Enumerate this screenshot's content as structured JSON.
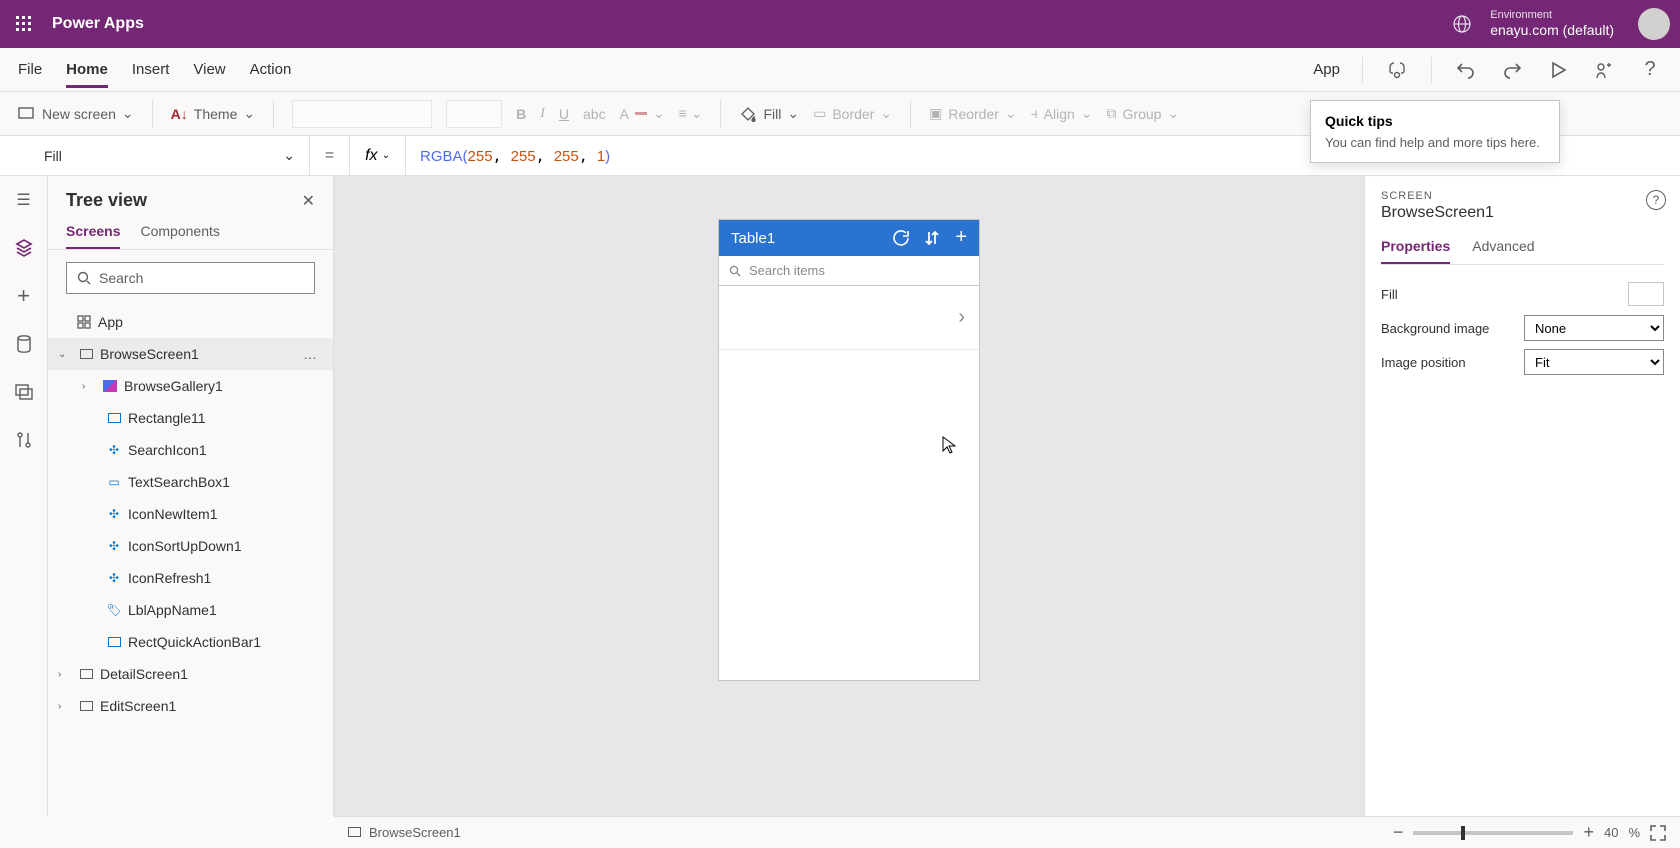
{
  "header": {
    "app_title": "Power Apps",
    "env_label": "Environment",
    "env_value": "enayu.com (default)"
  },
  "menu": {
    "items": [
      "File",
      "Home",
      "Insert",
      "View",
      "Action"
    ],
    "active_index": 1,
    "right": {
      "app_label": "App"
    }
  },
  "ribbon": {
    "new_screen": "New screen",
    "theme": "Theme",
    "fill": "Fill",
    "border": "Border",
    "reorder": "Reorder",
    "align": "Align",
    "group": "Group"
  },
  "formula": {
    "property": "Fill",
    "fn": "RGBA",
    "args": [
      "255",
      "255",
      "255",
      "1"
    ]
  },
  "tree": {
    "title": "Tree view",
    "tabs": [
      "Screens",
      "Components"
    ],
    "active_tab": 0,
    "search_placeholder": "Search",
    "nodes": {
      "app": "App",
      "browse_screen": "BrowseScreen1",
      "browse_gallery": "BrowseGallery1",
      "rectangle11": "Rectangle11",
      "search_icon1": "SearchIcon1",
      "text_search_box1": "TextSearchBox1",
      "icon_new_item1": "IconNewItem1",
      "icon_sort_updown1": "IconSortUpDown1",
      "icon_refresh1": "IconRefresh1",
      "lbl_app_name1": "LblAppName1",
      "rect_quick_action_bar1": "RectQuickActionBar1",
      "detail_screen": "DetailScreen1",
      "edit_screen": "EditScreen1"
    }
  },
  "canvas": {
    "table_title": "Table1",
    "search_placeholder": "Search items"
  },
  "properties": {
    "type_label": "SCREEN",
    "name": "BrowseScreen1",
    "tabs": [
      "Properties",
      "Advanced"
    ],
    "active_tab": 0,
    "rows": {
      "fill_label": "Fill",
      "bg_image_label": "Background image",
      "bg_image_value": "None",
      "img_pos_label": "Image position",
      "img_pos_value": "Fit"
    }
  },
  "quick_tips": {
    "title": "Quick tips",
    "body": "You can find help and more tips here."
  },
  "status": {
    "screen": "BrowseScreen1",
    "zoom": "40",
    "percent": "%"
  }
}
